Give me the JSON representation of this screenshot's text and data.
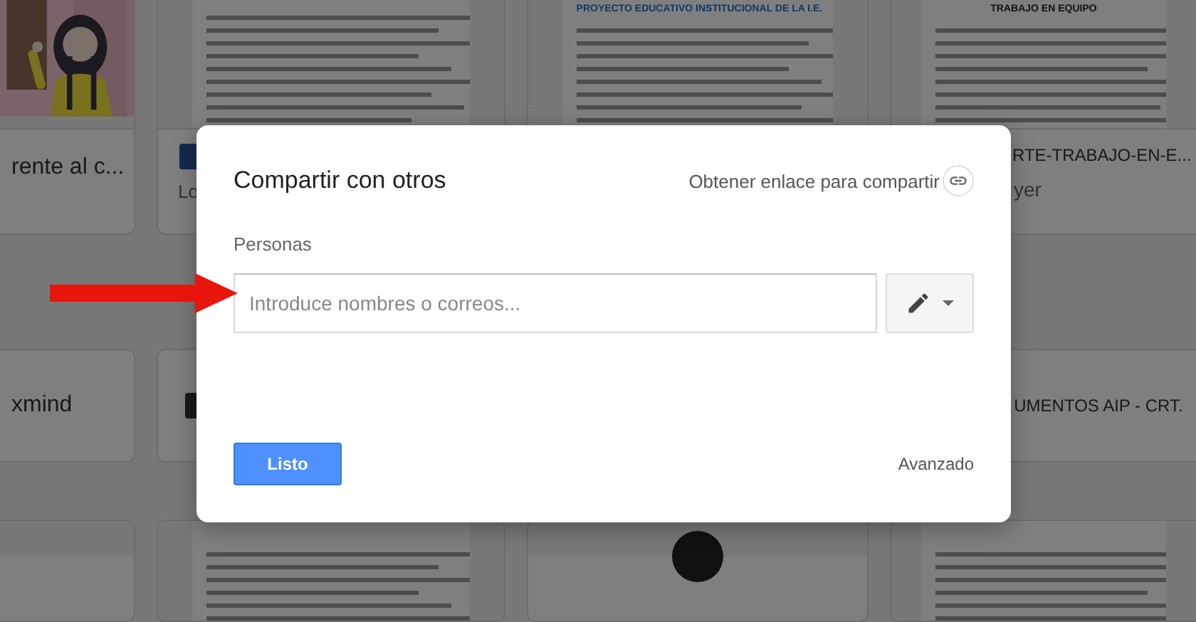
{
  "background": {
    "rows": [
      {
        "kind": "top",
        "cards": [
          {
            "kind": "picture",
            "title": "rente al c..."
          },
          {
            "kind": "document",
            "subtitle": "Lo"
          },
          {
            "kind": "document",
            "heading": "PROYECTO EDUCATIVO INSTITUCIONAL DE LA I.E."
          },
          {
            "kind": "document",
            "heading": "TRABAJO EN EQUIPO",
            "title": "RTE-TRABAJO-EN-E...",
            "subtitle": "yer"
          }
        ]
      },
      {
        "kind": "middle",
        "cards": [
          {
            "kind": "title",
            "title": "xmind"
          },
          {
            "kind": "title"
          },
          {
            "kind": "title",
            "title": "UMENTOS AIP - CRT."
          }
        ]
      },
      {
        "kind": "bottom",
        "cards": [
          {
            "kind": "blank"
          },
          {
            "kind": "document"
          },
          {
            "kind": "circle"
          },
          {
            "kind": "document"
          }
        ]
      }
    ]
  },
  "dialog": {
    "title": "Compartir con otros",
    "link": "Obtener enlace para compartir",
    "people_label": "Personas",
    "people_field": {
      "placeholder": "Introduce nombres o correos..."
    },
    "done_button": "Listo",
    "advanced_link": "Avanzado"
  }
}
